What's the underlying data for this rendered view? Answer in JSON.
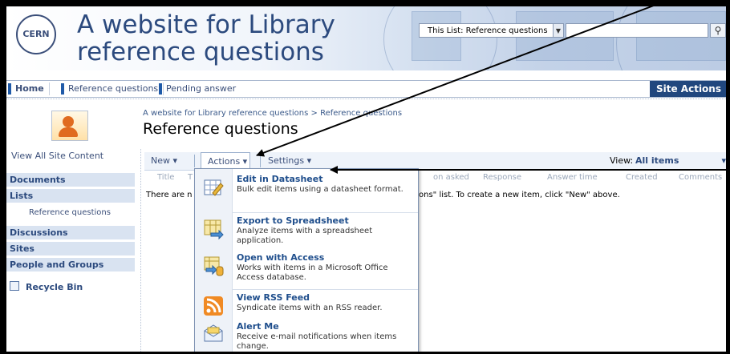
{
  "header": {
    "logo_text": "CERN",
    "site_title_line1": "A website for Library",
    "site_title_line2": "reference questions",
    "search_scope": "This List: Reference questions",
    "search_input": "",
    "search_icon": "magnifier-icon"
  },
  "topnav": {
    "tabs": [
      "Home",
      "Reference questions",
      "Pending answer"
    ],
    "site_actions": "Site Actions ▾"
  },
  "page": {
    "breadcrumb": "A website for Library reference questions > Reference questions",
    "title": "Reference questions"
  },
  "quick_launch": {
    "view_all": "View All Site Content",
    "documents": "Documents",
    "lists": "Lists",
    "lists_item": "Reference questions",
    "discussions": "Discussions",
    "sites": "Sites",
    "people": "People and Groups",
    "recycle": "Recycle Bin"
  },
  "toolbar": {
    "new": "New  ▾",
    "actions": "Actions ▾",
    "settings": "Settings ▾",
    "view_label": "View:",
    "view_value": "All items"
  },
  "list": {
    "columns": [
      "Title",
      "T",
      "on asked",
      "Response",
      "Answer time",
      "Created",
      "Comments"
    ],
    "empty_left": "There are n",
    "empty_right": "ons\" list. To create a new item, click \"New\" above."
  },
  "actions_menu": {
    "items": [
      {
        "title": "Edit in Datasheet",
        "desc": "Bulk edit items using a datasheet format.",
        "icon": "datasheet-edit-icon"
      },
      {
        "title": "Export to Spreadsheet",
        "desc": "Analyze items with a spreadsheet application.",
        "icon": "spreadsheet-export-icon"
      },
      {
        "title": "Open with Access",
        "desc": "Works with items in a Microsoft Office Access database.",
        "icon": "access-database-icon"
      },
      {
        "title": "View RSS Feed",
        "desc": "Syndicate items with an RSS reader.",
        "icon": "rss-feed-icon"
      },
      {
        "title": "Alert Me",
        "desc": "Receive e-mail notifications when items change.",
        "icon": "alert-envelope-icon"
      }
    ]
  }
}
